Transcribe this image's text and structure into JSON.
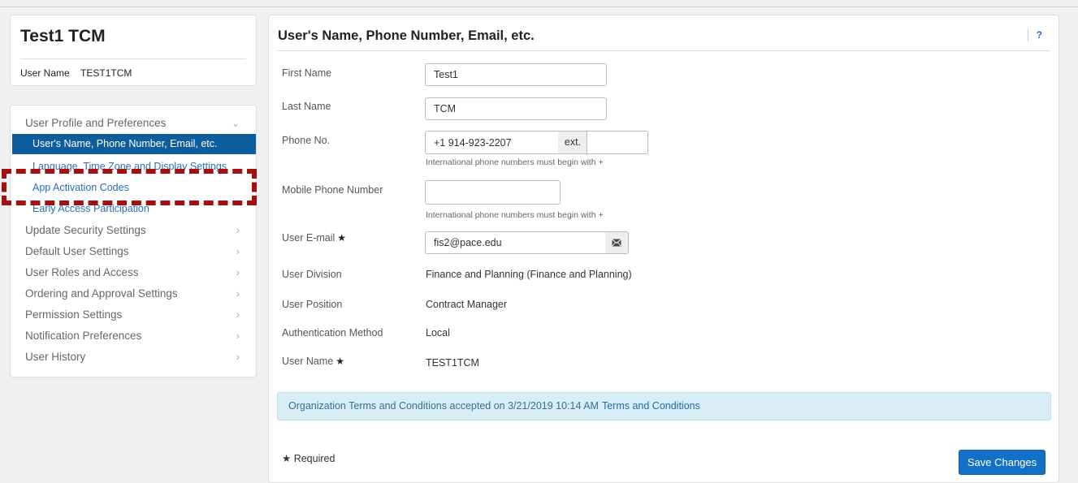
{
  "profile": {
    "display_name": "Test1 TCM",
    "user_name_label": "User Name",
    "user_name_value": "TEST1TCM"
  },
  "nav": {
    "section_title": "User Profile and Preferences",
    "sub_items": [
      "User's Name, Phone Number, Email, etc.",
      "Language, Time Zone and Display Settings",
      "App Activation Codes",
      "Early Access Participation"
    ],
    "items": [
      "Update Security Settings",
      "Default User Settings",
      "User Roles and Access",
      "Ordering and Approval Settings",
      "Permission Settings",
      "Notification Preferences",
      "User History"
    ],
    "chevron_right": "›",
    "chevron_down": "⌄"
  },
  "panel": {
    "title": "User's Name, Phone Number, Email, etc.",
    "help": "?"
  },
  "form": {
    "first_name_label": "First Name",
    "first_name_value": "Test1",
    "last_name_label": "Last Name",
    "last_name_value": "TCM",
    "phone_label": "Phone No.",
    "phone_value": "+1 914-923-2207",
    "ext_label": "ext.",
    "ext_value": "",
    "phone_hint": "International phone numbers must begin with +",
    "mobile_label": "Mobile Phone Number",
    "mobile_value": "",
    "mobile_hint": "International phone numbers must begin with +",
    "email_label": "User E-mail",
    "email_value": "fis2@pace.edu",
    "division_label": "User Division",
    "division_value": "Finance and Planning (Finance and Planning)",
    "position_label": "User Position",
    "position_value": "Contract Manager",
    "auth_label": "Authentication Method",
    "auth_value": "Local",
    "username_label": "User Name",
    "username_value": "TEST1TCM",
    "required_star": "★"
  },
  "terms": {
    "text": "Organization Terms and Conditions accepted on 3/21/2019 10:14 AM",
    "link": "Terms and Conditions"
  },
  "footer": {
    "required_note": "Required",
    "save_label": "Save Changes"
  },
  "colors": {
    "active_nav_bg": "#0e5e9e",
    "link": "#2a6ebb",
    "annotation_dash": "#a31010",
    "terms_bg": "#d9edf7",
    "primary_button": "#1271c4"
  }
}
